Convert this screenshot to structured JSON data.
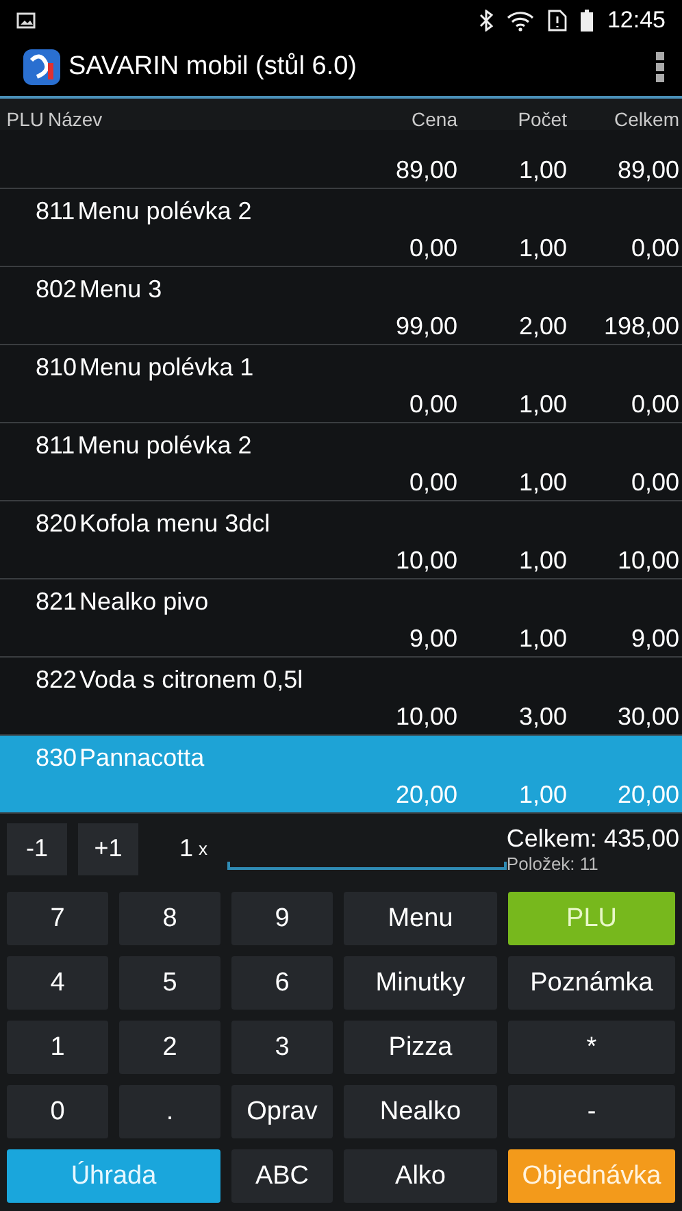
{
  "status_bar": {
    "time": "12:45"
  },
  "app_bar": {
    "title": "SAVARIN mobil (stůl 6.0)"
  },
  "table": {
    "columns": [
      "PLU",
      "Název",
      "Cena",
      "Počet",
      "Celkem"
    ],
    "rows": [
      {
        "price": "89,00",
        "qty": "1,00",
        "total": "89,00",
        "selected": false
      },
      {
        "plu": "811",
        "name": "Menu polévka 2",
        "price": "0,00",
        "qty": "1,00",
        "total": "0,00",
        "selected": false
      },
      {
        "plu": "802",
        "name": "Menu 3",
        "price": "99,00",
        "qty": "2,00",
        "total": "198,00",
        "selected": false
      },
      {
        "plu": "810",
        "name": "Menu polévka 1",
        "price": "0,00",
        "qty": "1,00",
        "total": "0,00",
        "selected": false
      },
      {
        "plu": "811",
        "name": "Menu polévka 2",
        "price": "0,00",
        "qty": "1,00",
        "total": "0,00",
        "selected": false
      },
      {
        "plu": "820",
        "name": "Kofola menu 3dcl",
        "price": "10,00",
        "qty": "1,00",
        "total": "10,00",
        "selected": false
      },
      {
        "plu": "821",
        "name": "Nealko pivo",
        "price": "9,00",
        "qty": "1,00",
        "total": "9,00",
        "selected": false
      },
      {
        "plu": "822",
        "name": "Voda s citronem 0,5l",
        "price": "10,00",
        "qty": "3,00",
        "total": "30,00",
        "selected": false
      },
      {
        "plu": "830",
        "name": "Pannacotta",
        "price": "20,00",
        "qty": "1,00",
        "total": "20,00",
        "selected": true
      }
    ]
  },
  "quantity_bar": {
    "minus": "-1",
    "plus": "+1",
    "quantity": "1",
    "times": "x",
    "total": "Celkem: 435,00",
    "items": "Položek: 11"
  },
  "keypad": [
    {
      "label": "7",
      "kind": "plain"
    },
    {
      "label": "8",
      "kind": "plain"
    },
    {
      "label": "9",
      "kind": "plain"
    },
    {
      "label": "Menu",
      "kind": "plain"
    },
    {
      "label": "PLU",
      "kind": "plu"
    },
    {
      "label": "4",
      "kind": "plain"
    },
    {
      "label": "5",
      "kind": "plain"
    },
    {
      "label": "6",
      "kind": "plain"
    },
    {
      "label": "Minutky",
      "kind": "plain"
    },
    {
      "label": "Poznámka",
      "kind": "plain"
    },
    {
      "label": "1",
      "kind": "plain"
    },
    {
      "label": "2",
      "kind": "plain"
    },
    {
      "label": "3",
      "kind": "plain"
    },
    {
      "label": "Pizza",
      "kind": "plain"
    },
    {
      "label": "*",
      "kind": "plain"
    },
    {
      "label": "0",
      "kind": "plain"
    },
    {
      "label": ".",
      "kind": "plain"
    },
    {
      "label": "Oprav",
      "kind": "plain"
    },
    {
      "label": "Nealko",
      "kind": "plain"
    },
    {
      "label": "-",
      "kind": "plain"
    },
    {
      "label": "Úhrada",
      "kind": "pay"
    },
    {
      "label": "ABC",
      "kind": "plain"
    },
    {
      "label": "Alko",
      "kind": "plain"
    },
    {
      "label": "Objednávka",
      "kind": "order"
    }
  ]
}
